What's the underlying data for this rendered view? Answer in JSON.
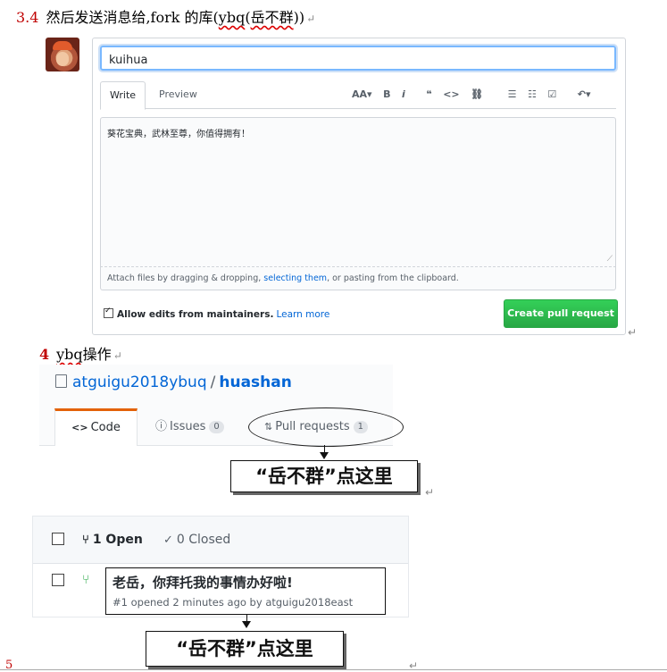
{
  "section_3_4": {
    "number": "3.4",
    "text_a": "然后发送消息给,fork 的库(",
    "text_user": "ybq",
    "text_b": "(",
    "text_name": "岳不群",
    "text_c": "))",
    "return_mark": "↵"
  },
  "pr_form": {
    "title_value": "kuihua",
    "tab_write": "Write",
    "tab_preview": "Preview",
    "toolbar": {
      "header": "AA▾",
      "bold": "B",
      "italic": "i",
      "quote": "❝",
      "code": "<>",
      "link": "⛓",
      "ul": "☰",
      "ol": "☷",
      "tasklist": "☑",
      "reply": "↶▾",
      "mention": "@",
      "bookmark": "▮"
    },
    "body_text": "葵花宝典，武林至尊，你值得拥有！",
    "resize_grip": "⟋",
    "attach_prefix": "Attach files by dragging & dropping, ",
    "attach_link": "selecting them",
    "attach_suffix": ", or pasting from the clipboard.",
    "allow_edits_label": "Allow edits from maintainers.",
    "learn_more": "Learn more",
    "create_button": "Create pull request"
  },
  "section_4": {
    "number": "4",
    "user": "ybq",
    "text": "操作",
    "return_mark": "↵"
  },
  "repo": {
    "owner": "atguigu2018ybuq",
    "separator": "/",
    "name": "huashan",
    "tab_code_icon": "<>",
    "tab_code": "Code",
    "tab_issues_icon": "ⓘ",
    "tab_issues": "Issues",
    "issues_count": "0",
    "tab_pulls_icon": "⇅",
    "tab_pulls": "Pull requests",
    "pulls_count": "1"
  },
  "callout_1": "“岳不群”点这里",
  "pulls_list": {
    "open_icon": "⑂",
    "open_label": "1 Open",
    "closed_icon": "✓",
    "closed_label": "0 Closed",
    "row_icon": "⑂",
    "row_title": "老岳，你拜托我的事情办好啦!",
    "row_meta": "#1 opened 2 minutes ago by atguigu2018east"
  },
  "callout_2": "“岳不群”点这里",
  "footer_number": "5",
  "return_mark": "↵"
}
